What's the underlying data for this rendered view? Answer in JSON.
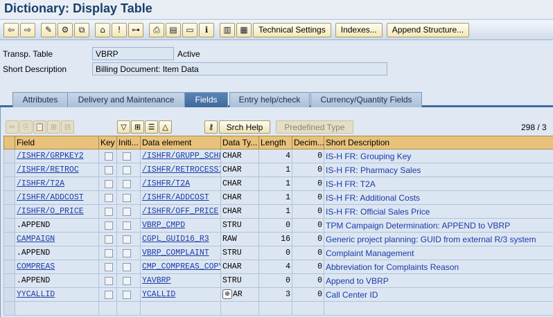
{
  "title": "Dictionary: Display Table",
  "toolbar": {
    "icons": [
      "back-icon",
      "forward-icon",
      "display-change-icon",
      "other-object-icon",
      "where-used-icon",
      "activate-icon",
      "check-icon",
      "hierarchy-icon",
      "print-icon",
      "layout-icon",
      "info-icon",
      "columns-icon",
      "grid-icon"
    ],
    "technical_settings": "Technical Settings",
    "indexes": "Indexes...",
    "append_structure": "Append Structure..."
  },
  "header": {
    "table_type_label": "Transp. Table",
    "table_name": "VBRP",
    "status": "Active",
    "short_desc_label": "Short Description",
    "short_desc": "Billing Document: Item Data"
  },
  "tabs": [
    {
      "label": "Attributes",
      "active": false
    },
    {
      "label": "Delivery and Maintenance",
      "active": false
    },
    {
      "label": "Fields",
      "active": true
    },
    {
      "label": "Entry help/check",
      "active": false
    },
    {
      "label": "Currency/Quantity Fields",
      "active": false
    }
  ],
  "panel_toolbar": {
    "srch_help": "Srch Help",
    "predefined_type": "Predefined Type",
    "counter": "298 / 3"
  },
  "columns": [
    "Field",
    "Key",
    "Initi...",
    "Data element",
    "Data Ty...",
    "Length",
    "Decim...",
    "Short Description"
  ],
  "rows": [
    {
      "field": "/ISHFR/GRPKEY2",
      "dataelement": "/ISHFR/GRUPP_SCHL",
      "datatype": "CHAR",
      "length": "4",
      "decimals": "0",
      "description": "IS-H FR: Grouping Key",
      "link": true
    },
    {
      "field": "/ISHFR/RETROC",
      "dataelement": "/ISHFR/RETROCESSI",
      "datatype": "CHAR",
      "length": "1",
      "decimals": "0",
      "description": "IS-H FR: Pharmacy Sales",
      "link": true
    },
    {
      "field": "/ISHFR/T2A",
      "dataelement": "/ISHFR/T2A",
      "datatype": "CHAR",
      "length": "1",
      "decimals": "0",
      "description": "IS-H FR: T2A",
      "link": true
    },
    {
      "field": "/ISHFR/ADDCOST",
      "dataelement": "/ISHFR/ADDCOST",
      "datatype": "CHAR",
      "length": "1",
      "decimals": "0",
      "description": "IS-H FR: Additional Costs",
      "link": true
    },
    {
      "field": "/ISHFR/O_PRICE",
      "dataelement": "/ISHFR/OFF_PRICE",
      "datatype": "CHAR",
      "length": "1",
      "decimals": "0",
      "description": "IS-H FR: Official Sales Price",
      "link": true
    },
    {
      "field": ".APPEND",
      "dataelement": "VBRP_CMPD",
      "datatype": "STRU",
      "length": "0",
      "decimals": "0",
      "description": "TPM Campaign Determination: APPEND to VBRP",
      "link": false
    },
    {
      "field": "CAMPAIGN",
      "dataelement": "CGPL_GUID16_R3",
      "datatype": "RAW",
      "length": "16",
      "decimals": "0",
      "description": "Generic project planning: GUID from external R/3 system",
      "link": true
    },
    {
      "field": ".APPEND",
      "dataelement": "VBRP_COMPLAINT",
      "datatype": "STRU",
      "length": "0",
      "decimals": "0",
      "description": "Complaint Management",
      "link": false
    },
    {
      "field": "COMPREAS",
      "dataelement": "CMP_COMPREAS_COPY",
      "datatype": "CHAR",
      "length": "4",
      "decimals": "0",
      "description": "Abbreviation for Complaints Reason",
      "link": true
    },
    {
      "field": ".APPEND",
      "dataelement": "YAVBRP",
      "datatype": "STRU",
      "length": "0",
      "decimals": "0",
      "description": "Append to VBRP",
      "link": false
    },
    {
      "field": "YYCALLID",
      "dataelement": "YCALLID",
      "datatype": "AR",
      "length": "3",
      "decimals": "0",
      "description": "Call Center ID",
      "link": true,
      "f4": true
    }
  ]
}
